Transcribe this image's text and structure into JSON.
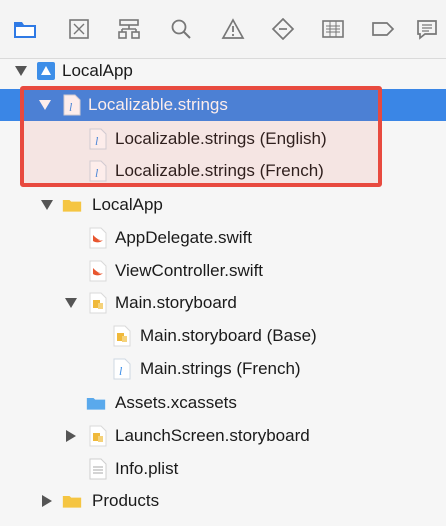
{
  "toolbar": {
    "icons": [
      "folder-icon",
      "source-control-icon",
      "hierarchy-icon",
      "search-icon",
      "warning-icon",
      "test-icon",
      "debug-icon",
      "breakpoint-icon",
      "report-icon"
    ]
  },
  "navigator": {
    "project": "LocalApp",
    "localizable_group": "Localizable.strings",
    "localizable_english": "Localizable.strings (English)",
    "localizable_french": "Localizable.strings (French)",
    "group_localapp": "LocalApp",
    "appdelegate": "AppDelegate.swift",
    "viewcontroller": "ViewController.swift",
    "main_storyboard": "Main.storyboard",
    "main_storyboard_base": "Main.storyboard (Base)",
    "main_strings_french": "Main.strings (French)",
    "assets": "Assets.xcassets",
    "launchscreen": "LaunchScreen.storyboard",
    "infoplist": "Info.plist",
    "products": "Products"
  },
  "colors": {
    "selection": "#3a86e6",
    "highlight_border": "#e84a3f",
    "folder_yellow": "#f5c542",
    "swift_orange": "#e8562f"
  }
}
